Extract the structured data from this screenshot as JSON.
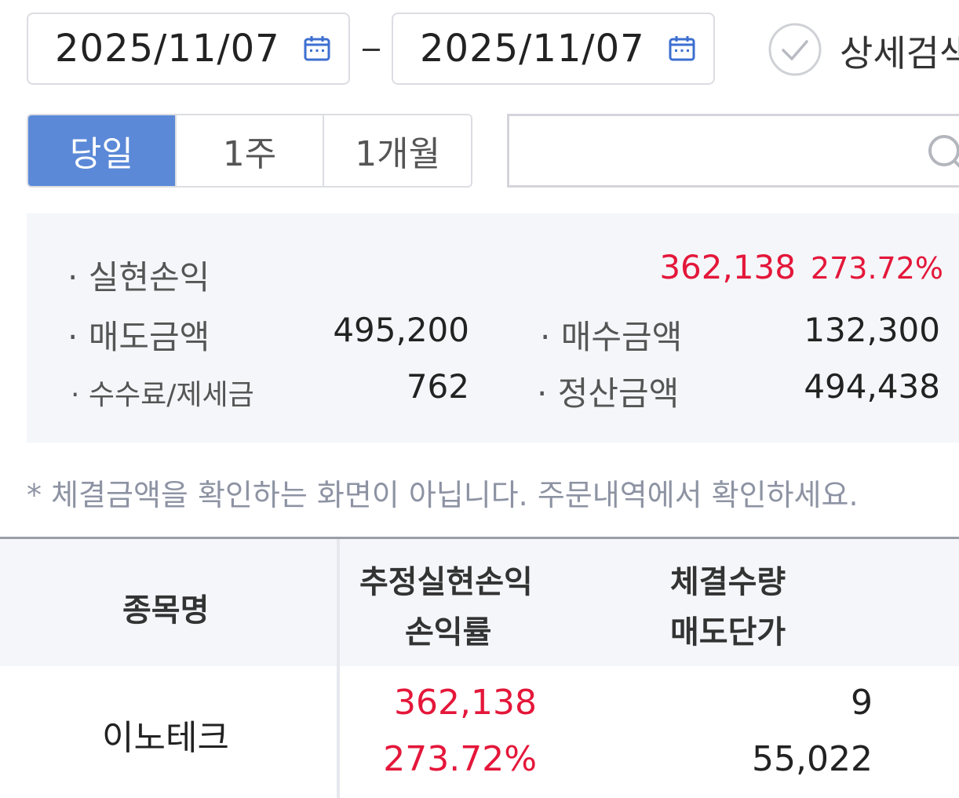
{
  "filters": {
    "start_date": "2025/11/07",
    "end_date": "2025/11/07",
    "detail_search_label": "상세검색"
  },
  "period": {
    "options": [
      "당일",
      "1주",
      "1개월"
    ],
    "selected": "당일"
  },
  "search": {
    "value": "",
    "placeholder": ""
  },
  "summary": {
    "realized_label": "실현손익",
    "realized_value": "362,138",
    "realized_rate": "273.72%",
    "sell_amount_label": "매도금액",
    "sell_amount_value": "495,200",
    "buy_amount_label": "매수금액",
    "buy_amount_value": "132,300",
    "fee_tax_label": "수수료/제세금",
    "fee_tax_value": "762",
    "settle_label": "정산금액",
    "settle_value": "494,438"
  },
  "notice": "* 체결금액을 확인하는 화면이 아닙니다. 주문내역에서 확인하세요.",
  "table": {
    "headers": {
      "name": "종목명",
      "pnl_line1": "추정실현손익",
      "pnl_line2": "손익률",
      "qty_line1": "체결수량",
      "qty_line2": "매도단가"
    },
    "rows": [
      {
        "name": "이노테크",
        "pnl": "362,138",
        "rate": "273.72%",
        "qty": "9",
        "price": "55,022"
      }
    ]
  },
  "colors": {
    "accent": "#5b89d8",
    "profit": "#e4173a",
    "panel_bg": "#f4f6fa"
  }
}
